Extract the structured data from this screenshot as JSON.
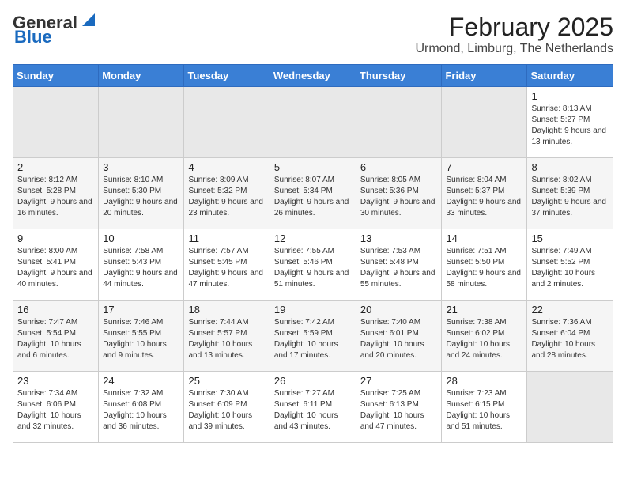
{
  "logo": {
    "line1": "General",
    "line2": "Blue"
  },
  "header": {
    "month": "February 2025",
    "location": "Urmond, Limburg, The Netherlands"
  },
  "weekdays": [
    "Sunday",
    "Monday",
    "Tuesday",
    "Wednesday",
    "Thursday",
    "Friday",
    "Saturday"
  ],
  "weeks": [
    [
      {
        "day": "",
        "info": ""
      },
      {
        "day": "",
        "info": ""
      },
      {
        "day": "",
        "info": ""
      },
      {
        "day": "",
        "info": ""
      },
      {
        "day": "",
        "info": ""
      },
      {
        "day": "",
        "info": ""
      },
      {
        "day": "1",
        "info": "Sunrise: 8:13 AM\nSunset: 5:27 PM\nDaylight: 9 hours and 13 minutes."
      }
    ],
    [
      {
        "day": "2",
        "info": "Sunrise: 8:12 AM\nSunset: 5:28 PM\nDaylight: 9 hours and 16 minutes."
      },
      {
        "day": "3",
        "info": "Sunrise: 8:10 AM\nSunset: 5:30 PM\nDaylight: 9 hours and 20 minutes."
      },
      {
        "day": "4",
        "info": "Sunrise: 8:09 AM\nSunset: 5:32 PM\nDaylight: 9 hours and 23 minutes."
      },
      {
        "day": "5",
        "info": "Sunrise: 8:07 AM\nSunset: 5:34 PM\nDaylight: 9 hours and 26 minutes."
      },
      {
        "day": "6",
        "info": "Sunrise: 8:05 AM\nSunset: 5:36 PM\nDaylight: 9 hours and 30 minutes."
      },
      {
        "day": "7",
        "info": "Sunrise: 8:04 AM\nSunset: 5:37 PM\nDaylight: 9 hours and 33 minutes."
      },
      {
        "day": "8",
        "info": "Sunrise: 8:02 AM\nSunset: 5:39 PM\nDaylight: 9 hours and 37 minutes."
      }
    ],
    [
      {
        "day": "9",
        "info": "Sunrise: 8:00 AM\nSunset: 5:41 PM\nDaylight: 9 hours and 40 minutes."
      },
      {
        "day": "10",
        "info": "Sunrise: 7:58 AM\nSunset: 5:43 PM\nDaylight: 9 hours and 44 minutes."
      },
      {
        "day": "11",
        "info": "Sunrise: 7:57 AM\nSunset: 5:45 PM\nDaylight: 9 hours and 47 minutes."
      },
      {
        "day": "12",
        "info": "Sunrise: 7:55 AM\nSunset: 5:46 PM\nDaylight: 9 hours and 51 minutes."
      },
      {
        "day": "13",
        "info": "Sunrise: 7:53 AM\nSunset: 5:48 PM\nDaylight: 9 hours and 55 minutes."
      },
      {
        "day": "14",
        "info": "Sunrise: 7:51 AM\nSunset: 5:50 PM\nDaylight: 9 hours and 58 minutes."
      },
      {
        "day": "15",
        "info": "Sunrise: 7:49 AM\nSunset: 5:52 PM\nDaylight: 10 hours and 2 minutes."
      }
    ],
    [
      {
        "day": "16",
        "info": "Sunrise: 7:47 AM\nSunset: 5:54 PM\nDaylight: 10 hours and 6 minutes."
      },
      {
        "day": "17",
        "info": "Sunrise: 7:46 AM\nSunset: 5:55 PM\nDaylight: 10 hours and 9 minutes."
      },
      {
        "day": "18",
        "info": "Sunrise: 7:44 AM\nSunset: 5:57 PM\nDaylight: 10 hours and 13 minutes."
      },
      {
        "day": "19",
        "info": "Sunrise: 7:42 AM\nSunset: 5:59 PM\nDaylight: 10 hours and 17 minutes."
      },
      {
        "day": "20",
        "info": "Sunrise: 7:40 AM\nSunset: 6:01 PM\nDaylight: 10 hours and 20 minutes."
      },
      {
        "day": "21",
        "info": "Sunrise: 7:38 AM\nSunset: 6:02 PM\nDaylight: 10 hours and 24 minutes."
      },
      {
        "day": "22",
        "info": "Sunrise: 7:36 AM\nSunset: 6:04 PM\nDaylight: 10 hours and 28 minutes."
      }
    ],
    [
      {
        "day": "23",
        "info": "Sunrise: 7:34 AM\nSunset: 6:06 PM\nDaylight: 10 hours and 32 minutes."
      },
      {
        "day": "24",
        "info": "Sunrise: 7:32 AM\nSunset: 6:08 PM\nDaylight: 10 hours and 36 minutes."
      },
      {
        "day": "25",
        "info": "Sunrise: 7:30 AM\nSunset: 6:09 PM\nDaylight: 10 hours and 39 minutes."
      },
      {
        "day": "26",
        "info": "Sunrise: 7:27 AM\nSunset: 6:11 PM\nDaylight: 10 hours and 43 minutes."
      },
      {
        "day": "27",
        "info": "Sunrise: 7:25 AM\nSunset: 6:13 PM\nDaylight: 10 hours and 47 minutes."
      },
      {
        "day": "28",
        "info": "Sunrise: 7:23 AM\nSunset: 6:15 PM\nDaylight: 10 hours and 51 minutes."
      },
      {
        "day": "",
        "info": ""
      }
    ]
  ]
}
